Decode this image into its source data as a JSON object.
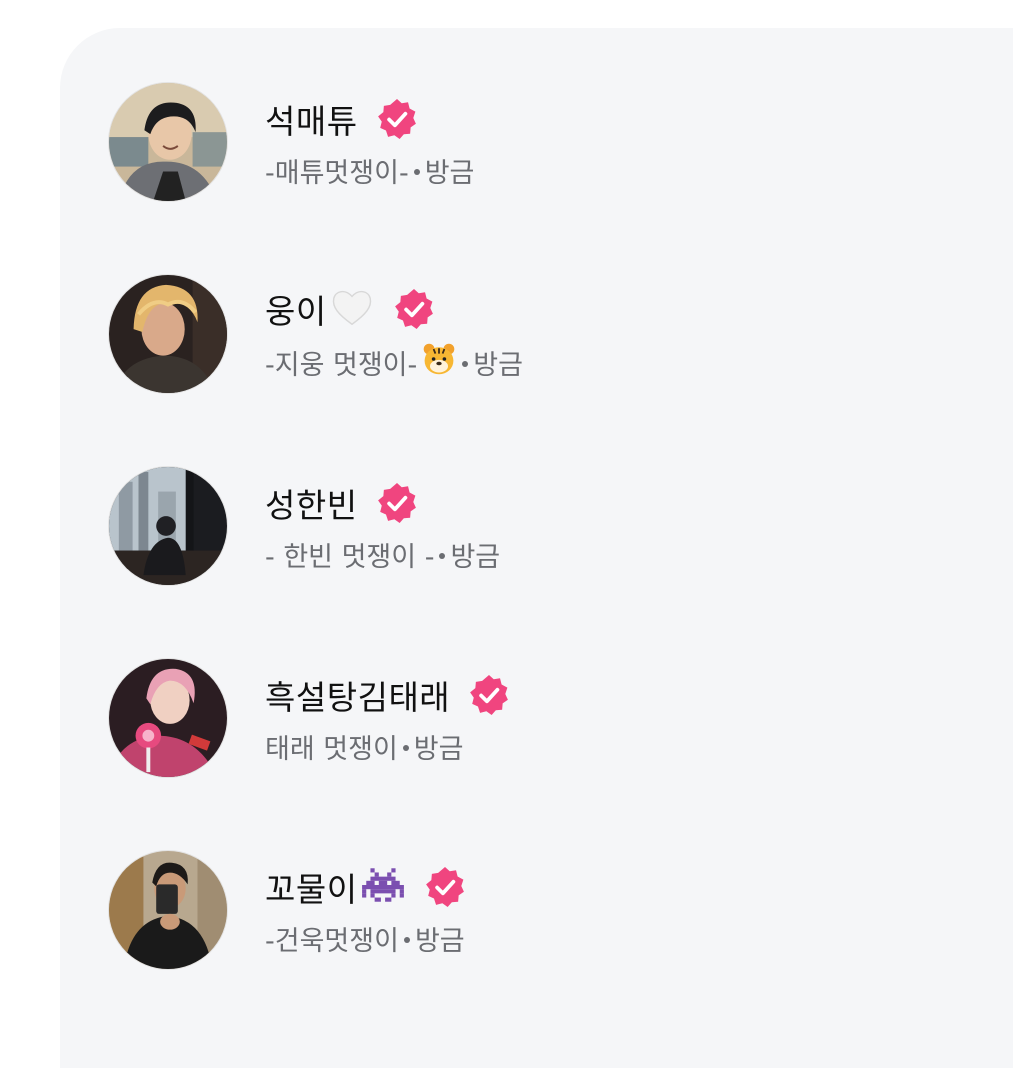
{
  "accent_color": "#f0457f",
  "friends": [
    {
      "name": "석매튜",
      "name_emoji_icon": "",
      "status": "-매튜멋쟁이-",
      "status_emoji_icon": "",
      "time": "방금",
      "verified": true
    },
    {
      "name": "웅이",
      "name_emoji_icon": "white-heart-icon",
      "status": "-지웅 멋쟁이-",
      "status_emoji_icon": "tiger-face-icon",
      "time": "방금",
      "verified": true
    },
    {
      "name": "성한빈",
      "name_emoji_icon": "",
      "status": "- 한빈 멋쟁이 -",
      "status_emoji_icon": "",
      "time": "방금",
      "verified": true
    },
    {
      "name": "흑설탕김태래",
      "name_emoji_icon": "",
      "status": "태래 멋쟁이",
      "status_emoji_icon": "",
      "time": "방금",
      "verified": true
    },
    {
      "name": "꼬물이",
      "name_emoji_icon": "space-invader-icon",
      "status": "-건욱멋쟁이",
      "status_emoji_icon": "",
      "time": "방금",
      "verified": true
    }
  ]
}
